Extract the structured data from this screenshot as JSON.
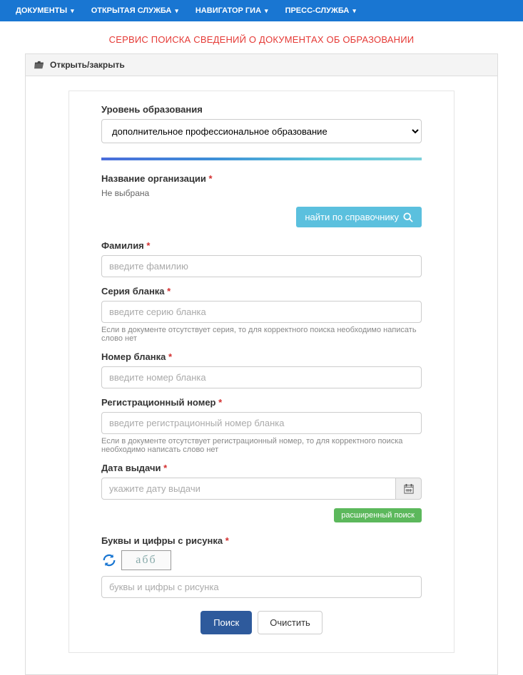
{
  "nav": {
    "items": [
      {
        "label": "ДОКУМЕНТЫ"
      },
      {
        "label": "ОТКРЫТАЯ СЛУЖБА"
      },
      {
        "label": "НАВИГАТОР ГИА"
      },
      {
        "label": "ПРЕСС-СЛУЖБА"
      }
    ]
  },
  "page_title": "СЕРВИС ПОИСКА СВЕДЕНИЙ О ДОКУМЕНТАХ ОБ ОБРАЗОВАНИИ",
  "panel": {
    "toggle_label": "Открыть/закрыть"
  },
  "form": {
    "level": {
      "label": "Уровень образования",
      "selected": "дополнительное профессиональное образование"
    },
    "org": {
      "label": "Название организации",
      "value": "Не выбрана",
      "lookup_btn": "найти по справочнику"
    },
    "lastname": {
      "label": "Фамилия",
      "placeholder": "введите фамилию"
    },
    "series": {
      "label": "Серия бланка",
      "placeholder": "введите серию бланка",
      "hint": "Если в документе отсутствует серия, то для корректного поиска необходимо написать слово нет"
    },
    "number": {
      "label": "Номер бланка",
      "placeholder": "введите номер бланка"
    },
    "reg": {
      "label": "Регистрационный номер",
      "placeholder": "введите регистрационный номер бланка",
      "hint": "Если в документе отсутствует регистрационный номер, то для корректного поиска необходимо написать слово нет"
    },
    "date": {
      "label": "Дата выдачи",
      "placeholder": "укажите дату выдачи"
    },
    "advanced": {
      "label": "расширенный поиск"
    },
    "captcha": {
      "label": "Буквы и цифры с рисунка",
      "placeholder": "буквы и цифры с рисунка",
      "sample": "абб"
    },
    "actions": {
      "search": "Поиск",
      "clear": "Очистить"
    }
  }
}
